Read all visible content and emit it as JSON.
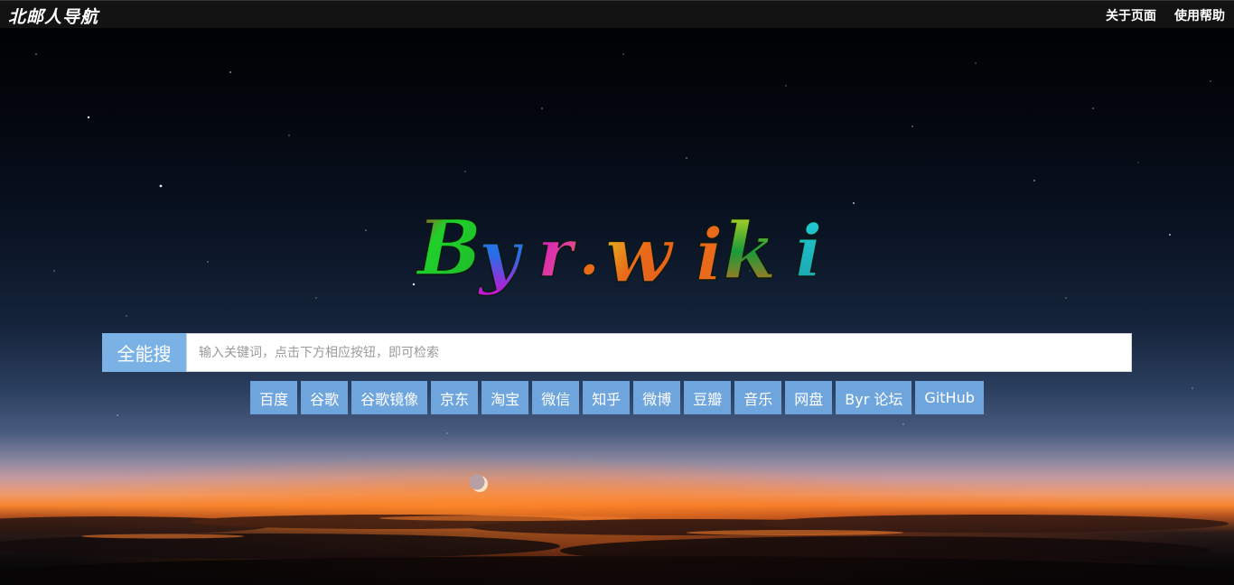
{
  "header": {
    "site_title": "北邮人导航",
    "nav": [
      {
        "label": "关于页面"
      },
      {
        "label": "使用帮助"
      }
    ]
  },
  "logo": {
    "text": "Byr.wiki",
    "colors": [
      "#1fd12a",
      "#2a6be6",
      "#d10fd1",
      "#e86a1a",
      "#d8e020",
      "#1a9a3a",
      "#20d0d8"
    ]
  },
  "search": {
    "label": "全能搜",
    "placeholder": "输入关键词，点击下方相应按钮，即可检索",
    "value": ""
  },
  "engines": [
    {
      "label": "百度"
    },
    {
      "label": "谷歌"
    },
    {
      "label": "谷歌镜像"
    },
    {
      "label": "京东"
    },
    {
      "label": "淘宝"
    },
    {
      "label": "微信"
    },
    {
      "label": "知乎"
    },
    {
      "label": "微博"
    },
    {
      "label": "豆瓣"
    },
    {
      "label": "音乐"
    },
    {
      "label": "网盘"
    },
    {
      "label": "Byr 论坛"
    },
    {
      "label": "GitHub"
    }
  ],
  "colors": {
    "accent": "#7ab2e6",
    "button": "#6fa5dd",
    "topbar": "#161616"
  },
  "background": {
    "image": "night-sky-sunset",
    "moon_icon": "crescent-moon-icon"
  }
}
